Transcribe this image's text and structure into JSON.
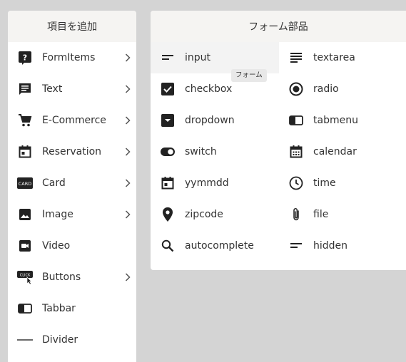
{
  "left_panel": {
    "title": "項目を追加",
    "items": [
      {
        "label": "FormItems",
        "icon": "help-box-icon",
        "has_submenu": true
      },
      {
        "label": "Text",
        "icon": "message-text-icon",
        "has_submenu": true
      },
      {
        "label": "E-Commerce",
        "icon": "shopping-cart-icon",
        "has_submenu": true
      },
      {
        "label": "Reservation",
        "icon": "calendar-icon",
        "has_submenu": true
      },
      {
        "label": "Card",
        "icon": "card-icon",
        "has_submenu": true
      },
      {
        "label": "Image",
        "icon": "image-icon",
        "has_submenu": true
      },
      {
        "label": "Video",
        "icon": "video-icon",
        "has_submenu": false
      },
      {
        "label": "Buttons",
        "icon": "click-button-icon",
        "has_submenu": true
      },
      {
        "label": "Tabbar",
        "icon": "tabbar-icon",
        "has_submenu": false
      },
      {
        "label": "Divider",
        "icon": "divider-line-icon",
        "has_submenu": false
      }
    ],
    "card_icon_text": "CARD",
    "click_icon_text": "CLICK"
  },
  "right_panel": {
    "title": "フォーム部品",
    "items": [
      {
        "label": "input",
        "icon": "short-text-icon"
      },
      {
        "label": "textarea",
        "icon": "text-lines-icon"
      },
      {
        "label": "checkbox",
        "icon": "checkbox-icon"
      },
      {
        "label": "radio",
        "icon": "radio-icon"
      },
      {
        "label": "dropdown",
        "icon": "dropdown-icon"
      },
      {
        "label": "tabmenu",
        "icon": "tabmenu-icon"
      },
      {
        "label": "switch",
        "icon": "switch-icon"
      },
      {
        "label": "calendar",
        "icon": "calendar-dotted-icon"
      },
      {
        "label": "yymmdd",
        "icon": "date-icon"
      },
      {
        "label": "time",
        "icon": "clock-icon"
      },
      {
        "label": "zipcode",
        "icon": "map-pin-icon"
      },
      {
        "label": "file",
        "icon": "paperclip-icon"
      },
      {
        "label": "autocomplete",
        "icon": "search-icon"
      },
      {
        "label": "hidden",
        "icon": "hidden-text-icon"
      }
    ],
    "hovered_item": "input"
  },
  "tooltip": {
    "text": "フォーム"
  },
  "colors": {
    "background": "#d4d4d4",
    "panel": "#ffffff",
    "header": "#f5f4f2",
    "icon": "#222222",
    "text": "#333333",
    "hover": "#f3f3f3",
    "tooltip": "#e8e8e8"
  }
}
